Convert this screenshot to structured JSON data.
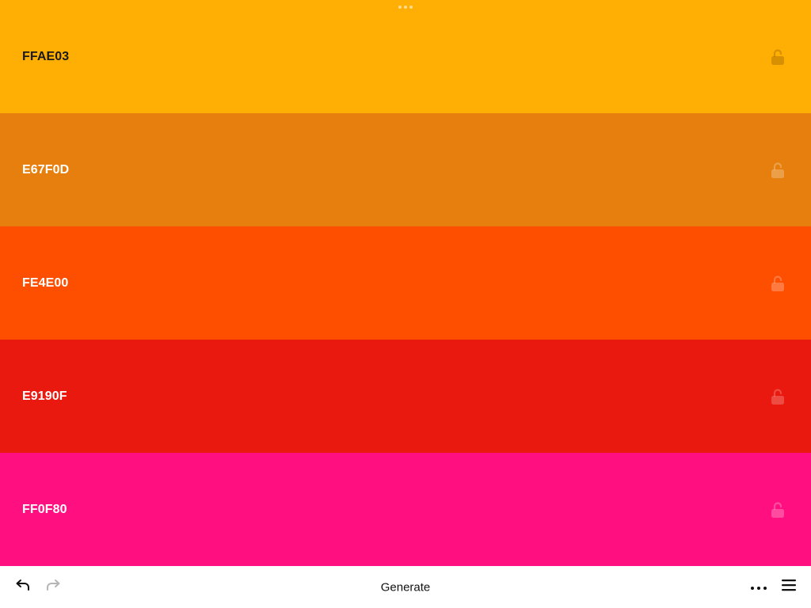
{
  "palette": {
    "colors": [
      {
        "hex": "FFAE03",
        "bg": "#FFAE03",
        "text_color": "#1a1a1a",
        "lock_color": "rgba(140,90,0,0.35)",
        "locked": false
      },
      {
        "hex": "E67F0D",
        "bg": "#E67F0D",
        "text_color": "#ffffff",
        "lock_color": "rgba(255,255,255,0.25)",
        "locked": false
      },
      {
        "hex": "FE4E00",
        "bg": "#FE4E00",
        "text_color": "#ffffff",
        "lock_color": "rgba(255,255,255,0.25)",
        "locked": false
      },
      {
        "hex": "E9190F",
        "bg": "#E9190F",
        "text_color": "#ffffff",
        "lock_color": "rgba(255,255,255,0.22)",
        "locked": false
      },
      {
        "hex": "FF0F80",
        "bg": "#FF0F80",
        "text_color": "#ffffff",
        "lock_color": "rgba(255,255,255,0.25)",
        "locked": false
      }
    ]
  },
  "toolbar": {
    "undo_icon": "undo-icon",
    "redo_icon": "redo-icon",
    "generate_label": "Generate",
    "more_icon": "more-horizontal-icon",
    "menu_icon": "hamburger-menu-icon"
  }
}
